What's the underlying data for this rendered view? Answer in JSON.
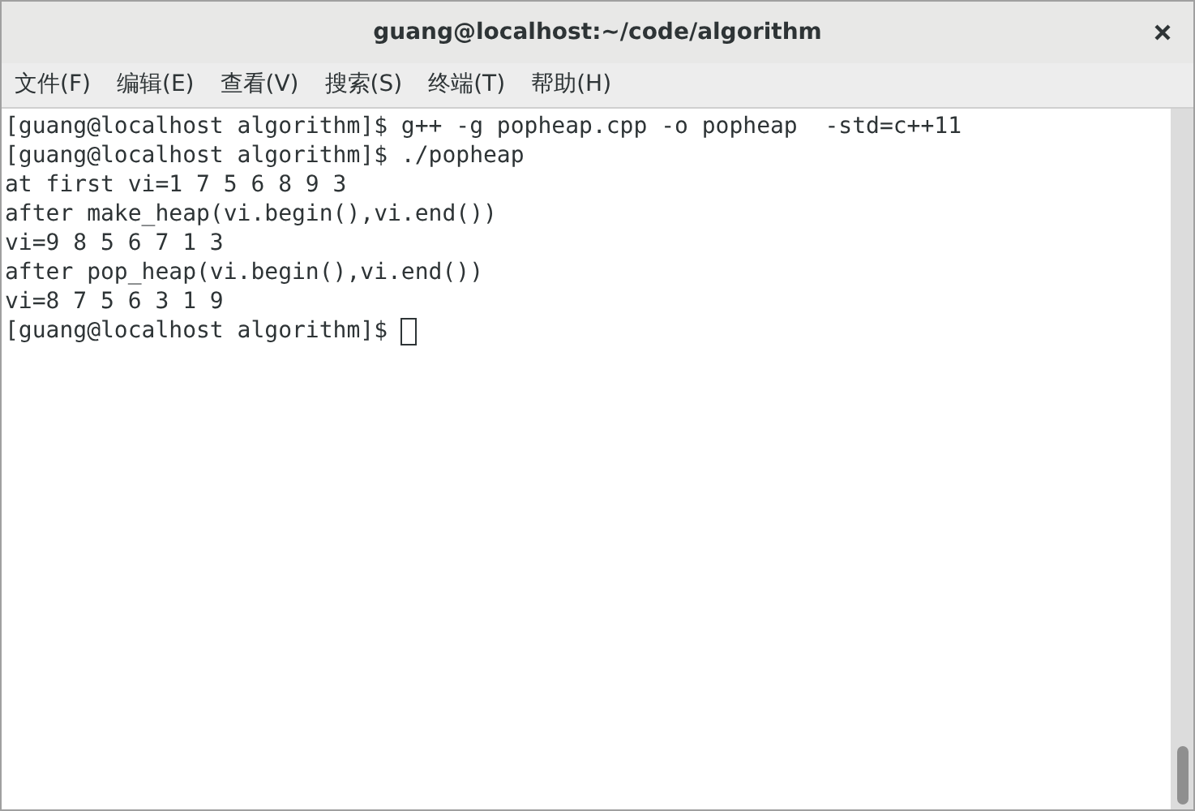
{
  "window": {
    "title": "guang@localhost:~/code/algorithm"
  },
  "menu": [
    "文件(F)",
    "编辑(E)",
    "查看(V)",
    "搜索(S)",
    "终端(T)",
    "帮助(H)"
  ],
  "terminal": {
    "lines": [
      {
        "text": "[guang@localhost algorithm]$ g++ -g popheap.cpp -o popheap  -std=c++11",
        "cursor": false
      },
      {
        "text": "[guang@localhost algorithm]$ ./popheap",
        "cursor": false
      },
      {
        "text": "at first vi=1 7 5 6 8 9 3",
        "cursor": false
      },
      {
        "text": "after make_heap(vi.begin(),vi.end())",
        "cursor": false
      },
      {
        "text": "vi=9 8 5 6 7 1 3",
        "cursor": false
      },
      {
        "text": "after pop_heap(vi.begin(),vi.end())",
        "cursor": false
      },
      {
        "text": "vi=8 7 5 6 3 1 9",
        "cursor": false
      },
      {
        "text": "[guang@localhost algorithm]$ ",
        "cursor": true
      }
    ]
  }
}
